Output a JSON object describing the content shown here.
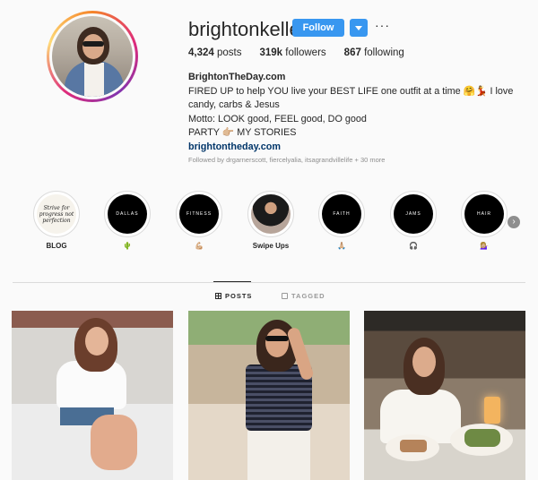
{
  "profile": {
    "username": "brightonkeller",
    "follow_label": "Follow",
    "more_label": "···",
    "stats": {
      "posts": "4,324",
      "posts_label": "posts",
      "followers": "319k",
      "followers_label": "followers",
      "following": "867",
      "following_label": "following"
    },
    "bio": {
      "name": "BrightonTheDay.com",
      "line1": "FIRED UP to help YOU live your BEST LIFE one outfit at a time 🤗💃 I love candy, carbs & Jesus",
      "line2": "Motto: LOOK good, FEEL good, DO good",
      "line3": "PARTY 👉🏼 MY STORIES",
      "link": "brightontheday.com"
    },
    "followed_by": "Followed by drgarnerscott, fiercelyalia, itsagrandvillelife + 30 more"
  },
  "highlights": [
    {
      "cover_text": "Strive for progress not perfection",
      "label": "BLOG",
      "style": "light"
    },
    {
      "cover_text": "DALLAS",
      "label": "🌵",
      "style": "dark"
    },
    {
      "cover_text": "FITNESS",
      "label": "💪🏼",
      "style": "dark"
    },
    {
      "cover_text": "",
      "label": "Swipe Ups",
      "style": "photo"
    },
    {
      "cover_text": "FAITH",
      "label": "🙏🏼",
      "style": "dark"
    },
    {
      "cover_text": "JAMS",
      "label": "🎧",
      "style": "dark"
    },
    {
      "cover_text": "HAIR",
      "label": "💁🏼‍♀️",
      "style": "dark"
    }
  ],
  "highlights_next_icon": "chevron-right-icon",
  "tabs": [
    {
      "label": "POSTS",
      "icon": "grid-icon",
      "active": true
    },
    {
      "label": "TAGGED",
      "icon": "tag-icon",
      "active": false
    }
  ],
  "colors": {
    "accent": "#3897f0",
    "link": "#003569",
    "muted": "#8e8e8e"
  }
}
